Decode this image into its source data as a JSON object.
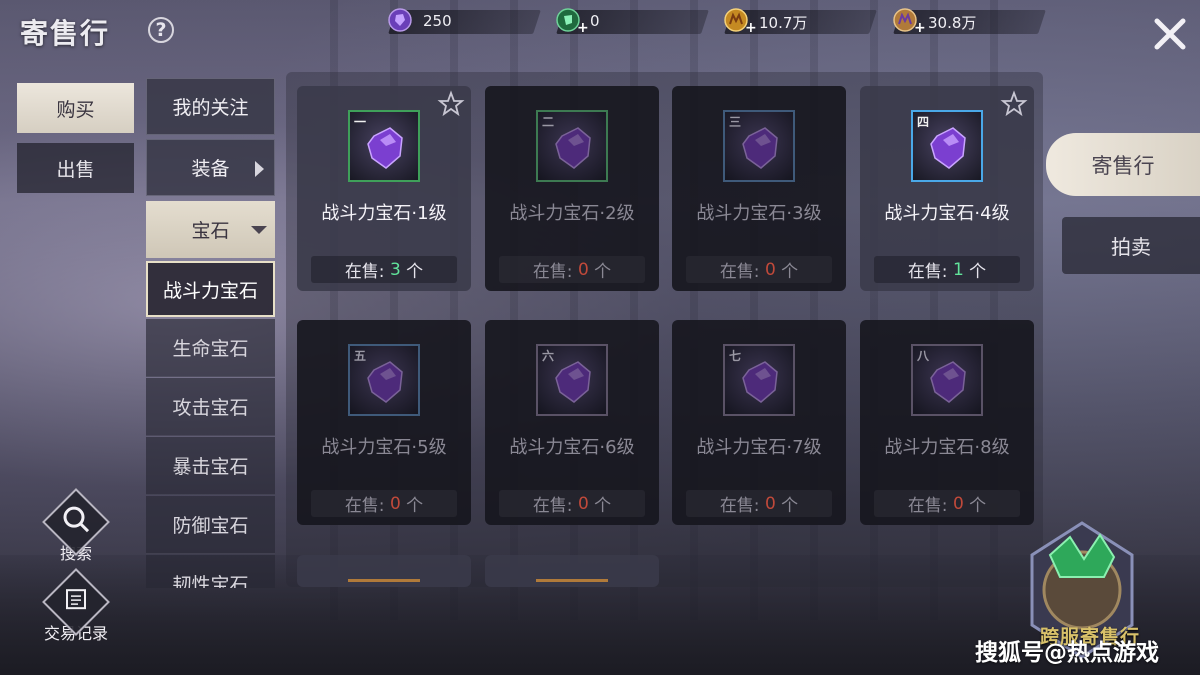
{
  "header": {
    "title": "寄售行",
    "help_icon": "?"
  },
  "currencies": [
    {
      "name": "purple-gem",
      "value": "250",
      "plus": "",
      "color": "#8a5cd6"
    },
    {
      "name": "green-gem",
      "value": "0",
      "plus": "+",
      "color": "#3fae6a"
    },
    {
      "name": "gold-coin",
      "value": "10.7万",
      "plus": "+",
      "color": "#d8a13a"
    },
    {
      "name": "bound-gold-coin",
      "value": "30.8万",
      "plus": "+",
      "color": "#c89a52"
    }
  ],
  "left_tabs": {
    "buy": "购买",
    "sell": "出售"
  },
  "categories": {
    "favorites": "我的关注",
    "equipment": "装备",
    "gems": "宝石",
    "sub": [
      "战斗力宝石",
      "生命宝石",
      "攻击宝石",
      "暴击宝石",
      "防御宝石",
      "韧性宝石"
    ]
  },
  "items": [
    {
      "tier": "一",
      "name": "战斗力宝石·1级",
      "sale_prefix": "在售: ",
      "count": "3",
      "unit": " 个",
      "state": "bright",
      "frame": "#3fa05a",
      "starred": false
    },
    {
      "tier": "二",
      "name": "战斗力宝石·2级",
      "sale_prefix": "在售: ",
      "count": "0",
      "unit": " 个",
      "state": "dim",
      "frame": "#3d7a52",
      "starred": false
    },
    {
      "tier": "三",
      "name": "战斗力宝石·3级",
      "sale_prefix": "在售: ",
      "count": "0",
      "unit": " 个",
      "state": "dim",
      "frame": "#3f5a7a",
      "starred": false
    },
    {
      "tier": "四",
      "name": "战斗力宝石·4级",
      "sale_prefix": "在售: ",
      "count": "1",
      "unit": " 个",
      "state": "bright",
      "frame": "#4aa8e8",
      "starred": false
    },
    {
      "tier": "五",
      "name": "战斗力宝石·5级",
      "sale_prefix": "在售: ",
      "count": "0",
      "unit": " 个",
      "state": "dim",
      "frame": "#3f5a7a",
      "starred": false
    },
    {
      "tier": "六",
      "name": "战斗力宝石·6级",
      "sale_prefix": "在售: ",
      "count": "0",
      "unit": " 个",
      "state": "dim",
      "frame": "#5a5266",
      "starred": false
    },
    {
      "tier": "七",
      "name": "战斗力宝石·7级",
      "sale_prefix": "在售: ",
      "count": "0",
      "unit": " 个",
      "state": "dim",
      "frame": "#5a5266",
      "starred": false
    },
    {
      "tier": "八",
      "name": "战斗力宝石·8级",
      "sale_prefix": "在售: ",
      "count": "0",
      "unit": " 个",
      "state": "dim",
      "frame": "#5a5266",
      "starred": false
    }
  ],
  "right_tabs": {
    "consign": "寄售行",
    "auction": "拍卖"
  },
  "bottom_buttons": {
    "search": "搜索",
    "records": "交易记录"
  },
  "promo_text": "跨服寄售行",
  "watermark": "搜狐号@热点游戏"
}
